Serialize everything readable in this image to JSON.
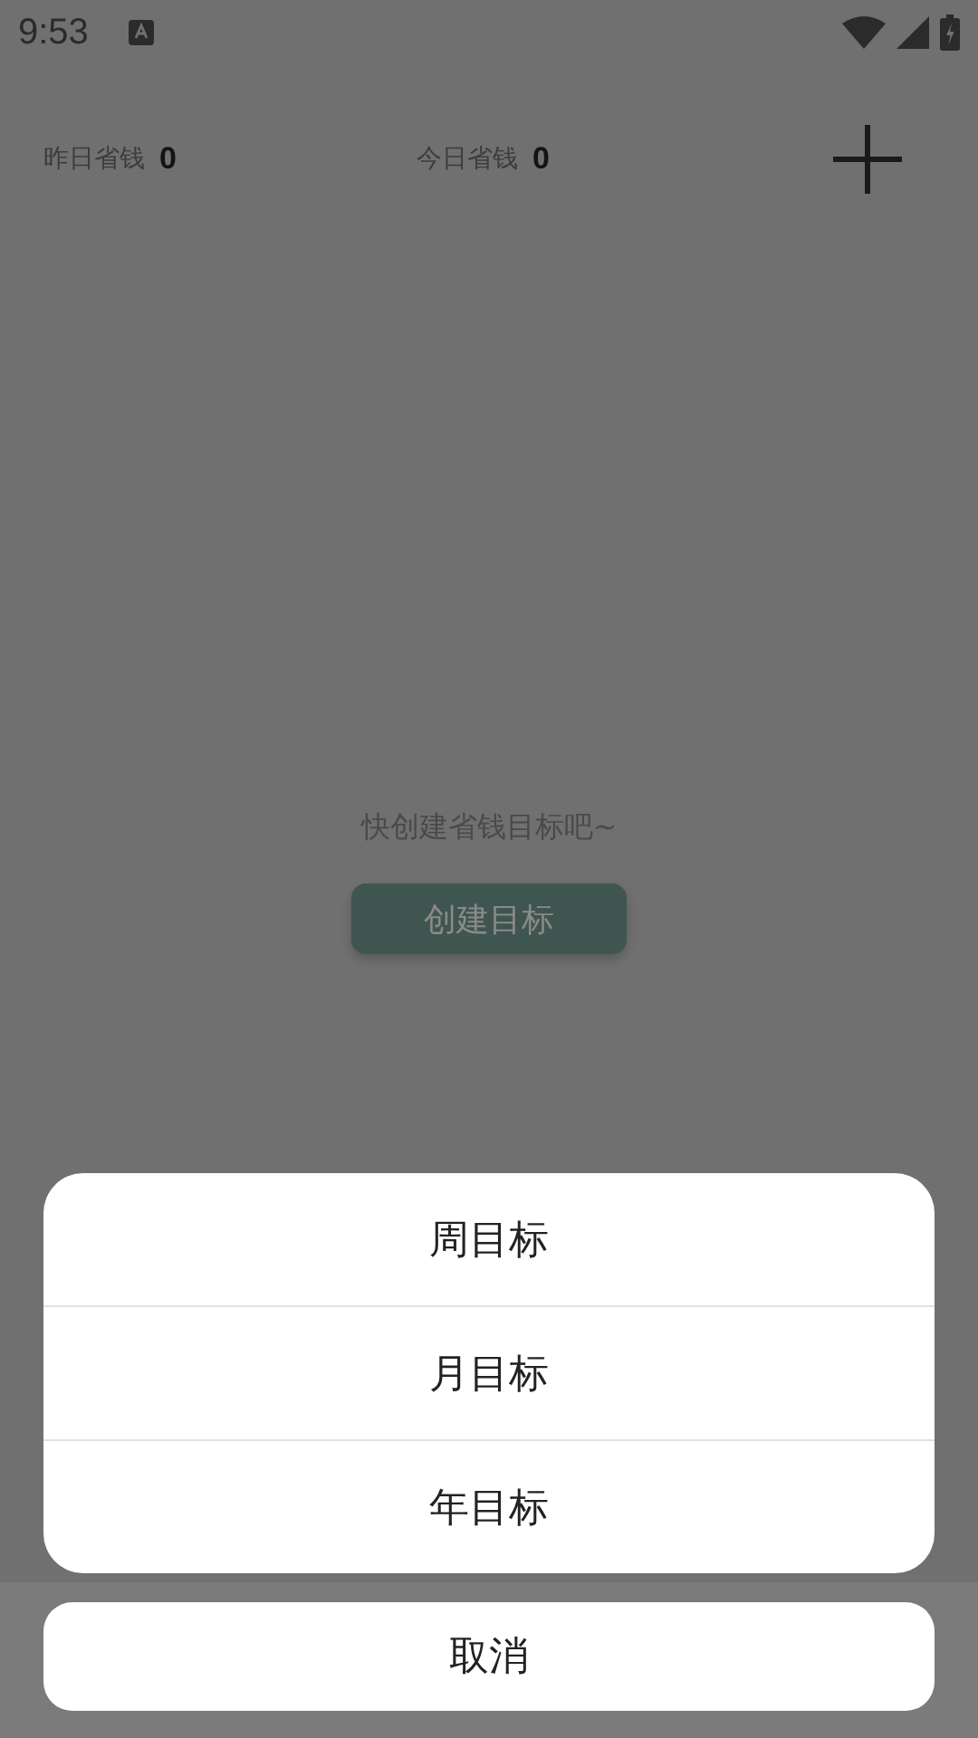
{
  "status_bar": {
    "time": "9:53"
  },
  "summary": [
    {
      "label": "昨日省钱",
      "value": "0"
    },
    {
      "label": "今日省钱",
      "value": "0"
    }
  ],
  "empty_state": {
    "message": "快创建省钱目标吧~",
    "button": "创建目标"
  },
  "action_sheet": {
    "options": [
      "周目标",
      "月目标",
      "年目标"
    ],
    "cancel": "取消"
  }
}
